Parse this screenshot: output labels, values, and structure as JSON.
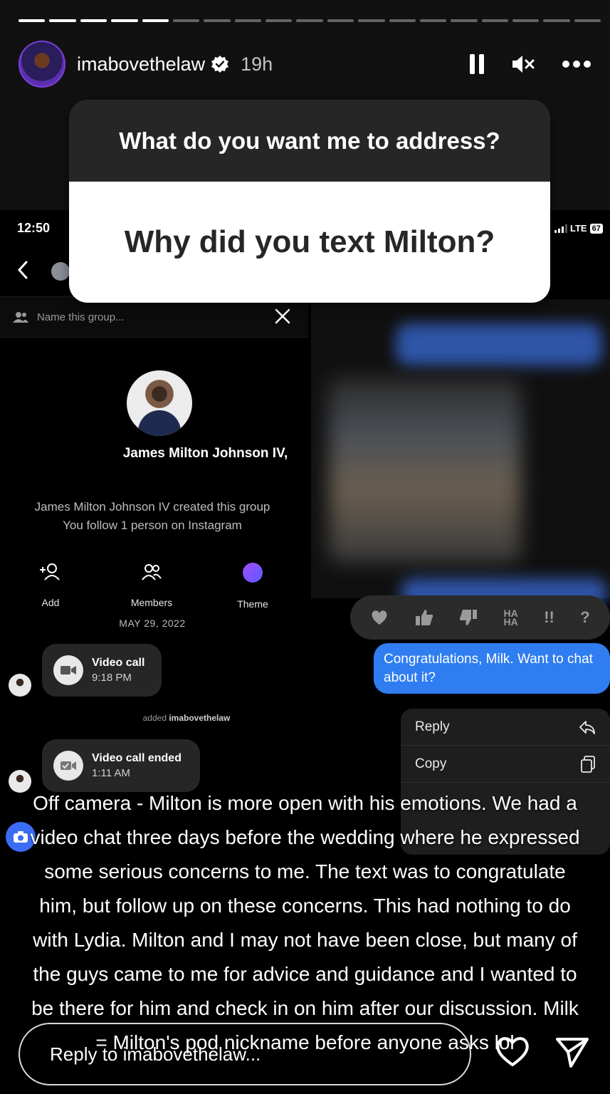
{
  "story": {
    "progress": {
      "total": 19,
      "completed": 5
    },
    "header": {
      "username": "imabovethelaw",
      "verified": true,
      "time": "19h",
      "icons": [
        "pause-icon",
        "muted-speaker-icon",
        "more-options-icon"
      ]
    },
    "question_sticker": {
      "prompt": "What do you want me to address?",
      "answer": "Why did you text Milton?"
    },
    "caption": "Off camera - Milton is more open with his emotions. We had a video chat three days before the wedding where he expressed some serious concerns to me. The text was to congratulate him, but follow up on these concerns. This had nothing to do with Lydia. Milton and I may not have been close, but many of the guys came to me for advice and guidance and I wanted to be there for him and check in on him after our discussion. Milk = Milton's pod nickname before anyone asks lol",
    "reply": {
      "placeholder": "Reply to imabovethelaw..."
    },
    "colors": {
      "accent_blue": "#2f7df0",
      "theme_purple": "#8a4dff"
    }
  },
  "screenshot": {
    "status_time": "12:50",
    "network": "LTE",
    "battery": "67",
    "group_name_placeholder": "Name this group...",
    "profile_name": "James Milton Johnson IV,",
    "info_created": "James Milton Johnson IV created this group",
    "info_follow": "You follow 1 person on Instagram",
    "actions": [
      {
        "label": "Add",
        "icon": "add-person-icon"
      },
      {
        "label": "Members",
        "icon": "members-icon"
      },
      {
        "label": "Theme",
        "icon": "theme-dot-icon"
      }
    ],
    "date": "MAY 29, 2022",
    "call1": {
      "title": "Video call",
      "time": "9:18 PM"
    },
    "added_text": "added",
    "added_user": "imabovethelaw",
    "call2": {
      "title": "Video call ended",
      "time": "1:11 AM"
    },
    "reactions": [
      "heart",
      "thumbs-up",
      "thumbs-down",
      "HA HA",
      "!!",
      "?"
    ],
    "reaction_haha": "HA\nHA",
    "reaction_exclaim": "!!",
    "reaction_question": "?",
    "message": "Congratulations, Milk. Want to chat about it?",
    "menu": [
      {
        "label": "Reply",
        "icon": "reply-arrow-icon"
      },
      {
        "label": "Copy",
        "icon": "copy-icon"
      }
    ]
  }
}
